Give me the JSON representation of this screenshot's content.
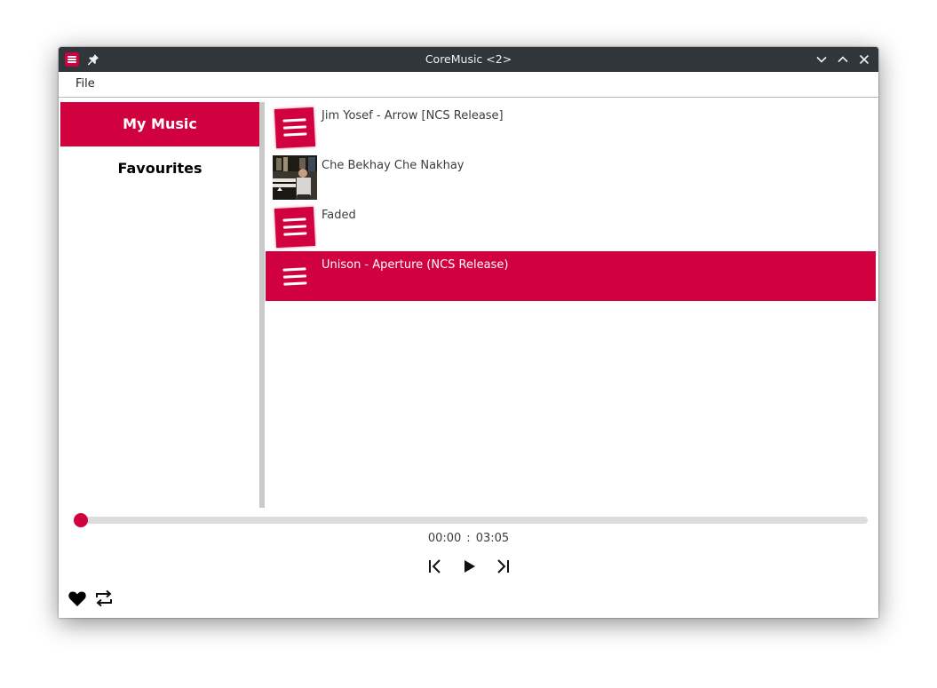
{
  "window": {
    "title": "CoreMusic <2>",
    "buttons": [
      "minimize",
      "maximize",
      "close"
    ]
  },
  "menu": {
    "file_label": "File"
  },
  "sidebar": {
    "items": [
      {
        "label": "My Music",
        "active": true
      },
      {
        "label": "Favourites",
        "active": false
      }
    ]
  },
  "tracks": [
    {
      "name": "Jim Yosef - Arrow [NCS Release]",
      "thumbnail": "app-logo",
      "selected": false
    },
    {
      "name": "Che Bekhay Che Nakhay",
      "thumbnail": "album-photo",
      "selected": false
    },
    {
      "name": "Faded",
      "thumbnail": "app-logo",
      "selected": false
    },
    {
      "name": "Unison - Aperture (NCS Release)",
      "thumbnail": "app-logo",
      "selected": true
    }
  ],
  "player": {
    "position": "00:00",
    "separator": ":",
    "duration": "03:05",
    "progress_fraction": 0.0,
    "favorite": true,
    "repeat": true
  },
  "colors": {
    "accent": "#d1003f",
    "titlebar": "#31363b",
    "divider": "#c9c9c9",
    "seek_bg": "#dcdcdc"
  },
  "icons": {
    "app": "coremusic-logo-icon",
    "pin": "pin-icon",
    "minimize": "chevron-down-icon",
    "maximize": "chevron-up-icon",
    "close": "close-icon",
    "previous": "skip-previous-icon",
    "play": "play-icon",
    "next": "skip-next-icon",
    "favorite": "heart-icon",
    "repeat": "repeat-icon"
  }
}
